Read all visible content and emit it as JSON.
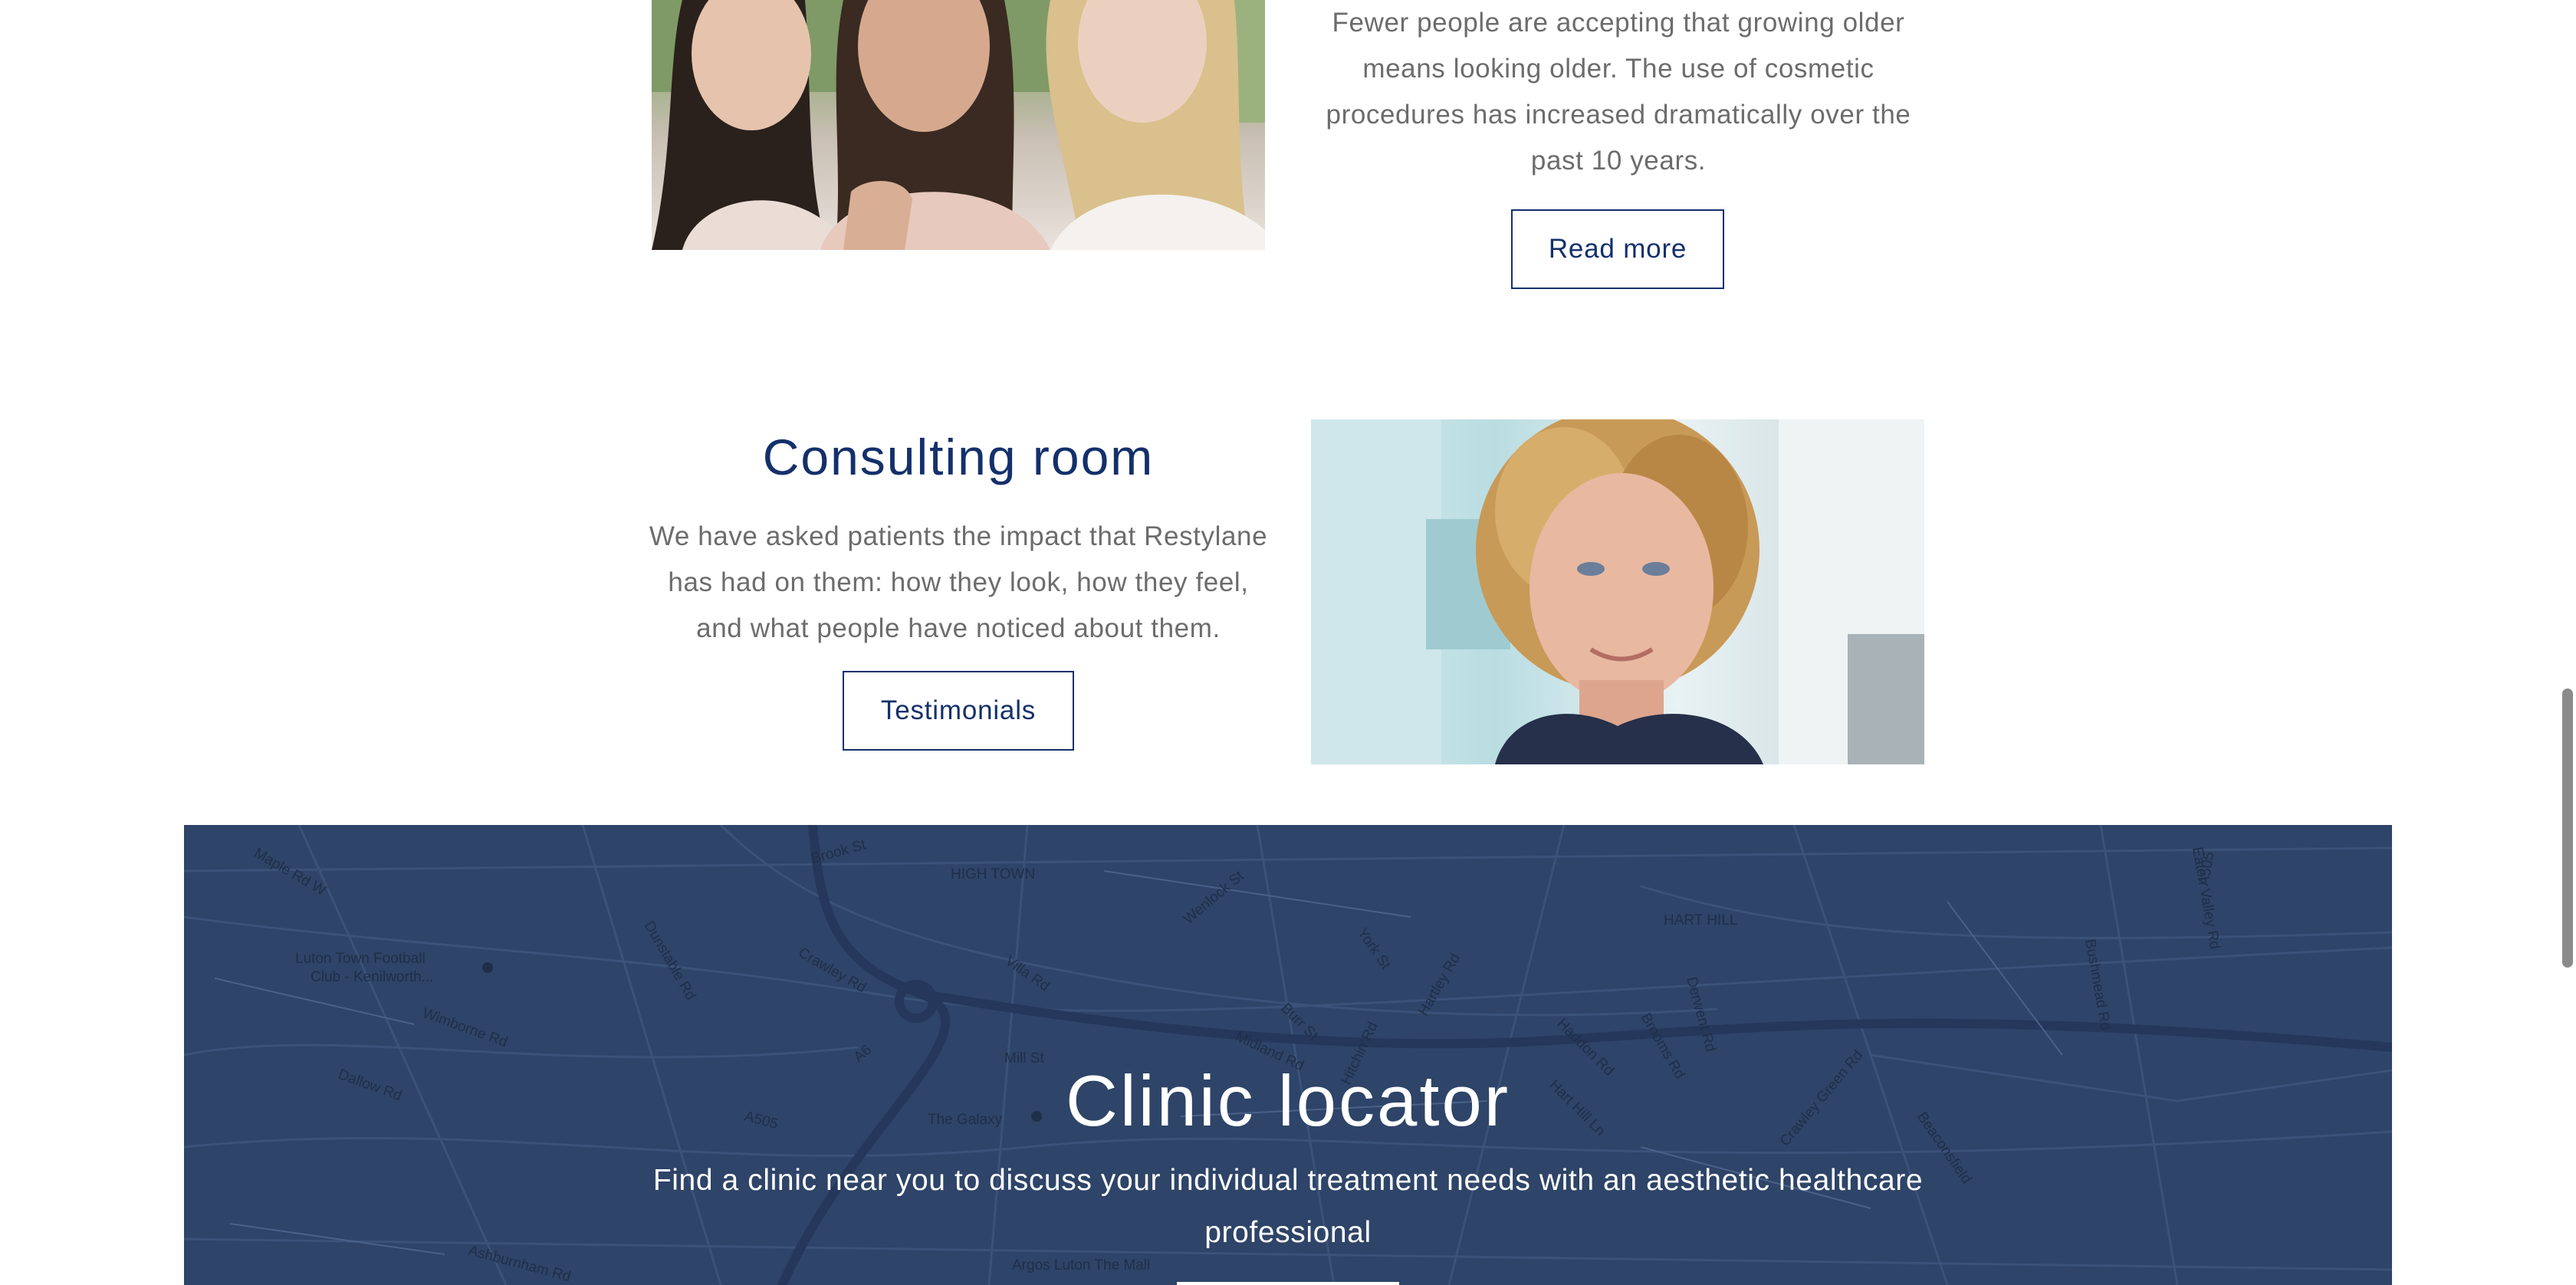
{
  "section_1": {
    "body_text": "Fewer people are accepting that growing older means looking older. The use of cosmetic procedures has increased dramatically over the past 10 years.",
    "button_label": "Read more"
  },
  "section_2": {
    "heading": "Consulting room",
    "body_text": "We have asked patients the impact that Restylane has had on them: how they look, how they feel, and what people have noticed about them.",
    "button_label": "Testimonials"
  },
  "clinic_locator": {
    "title": "Clinic locator",
    "description": "Find a clinic near you to discuss your individual treatment needs with an aesthetic healthcare professional",
    "map_labels": [
      "HIGH TOWN",
      "HART HILL",
      "Luton Town Football",
      "Club - Kenilworth...",
      "Brook St",
      "Wimborne Rd",
      "Dunstable Rd",
      "Crawley Rd",
      "Villa Rd",
      "Wenlock St",
      "Midland Rd",
      "Mill St",
      "A505",
      "A6",
      "The Galaxy",
      "Hitchin Rd",
      "Hartley Rd",
      "Crawley Green Rd",
      "Hart Hill Ln",
      "Dallow Rd",
      "Ashburnham Rd",
      "Argos Luton The Mall",
      "Burr St",
      "York St",
      "Brooms Rd",
      "Haddon Rd",
      "Derwent Rd",
      "Beaconsfield",
      "Eaton Valley Rd",
      "A505",
      "Bushmead Rd",
      "Maple Rd W"
    ],
    "map_background": "#2e4468"
  },
  "colors": {
    "brand_navy": "#14306b",
    "body_text": "#6c6c6c",
    "locator_bg": "#2e4468"
  }
}
